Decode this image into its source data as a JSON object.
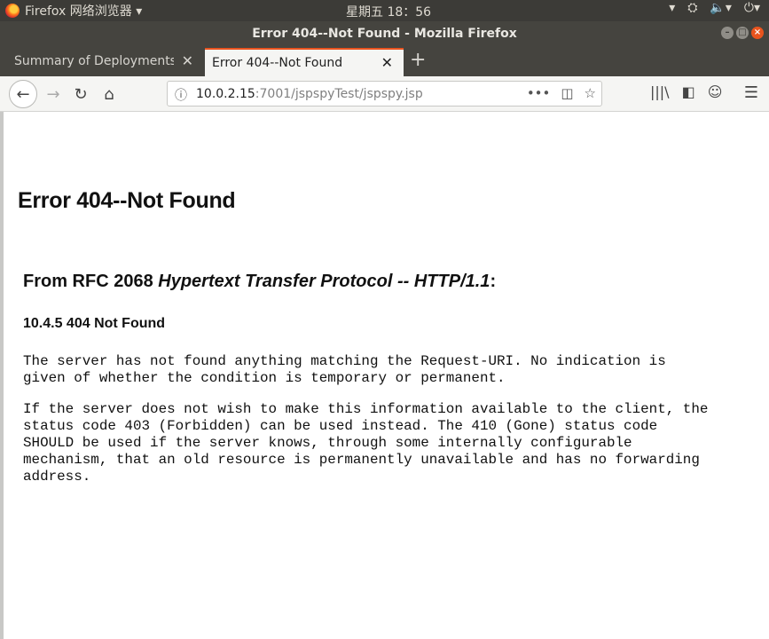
{
  "system_panel": {
    "app_name": "Firefox 网络浏览器 ▾",
    "clock": "星期五 18：56",
    "tray": {
      "dropdown": "▾",
      "network": "⛭",
      "volume": "🔈▾",
      "power": "⏻▾"
    }
  },
  "window": {
    "title": "Error 404--Not Found - Mozilla Firefox",
    "controls": {
      "minimize": "–",
      "maximize": "□",
      "close": "×"
    }
  },
  "tabs": [
    {
      "label": "Summary of Deployments - I",
      "close": "✕",
      "active": false
    },
    {
      "label": "Error 404--Not Found",
      "close": "✕",
      "active": true
    }
  ],
  "new_tab": "+",
  "urlbar": {
    "host": "10.0.2.15",
    "rest": ":7001/jspspyTest/jspspy.jsp",
    "info_icon": "ⓘ",
    "actions": {
      "more": "•••",
      "pocket": "◫",
      "star": "☆"
    }
  },
  "nav": {
    "back": "←",
    "forward": "→",
    "reload": "↻",
    "home": "⌂"
  },
  "toolbar_right": {
    "library": "|||\\",
    "sidebar": "◧",
    "account": "☺",
    "menu": "☰"
  },
  "page": {
    "heading": "Error 404--Not Found",
    "rfc_prefix": "From RFC 2068 ",
    "rfc_title": "Hypertext Transfer Protocol -- HTTP/1.1",
    "rfc_suffix": ":",
    "section": "10.4.5 404 Not Found",
    "para1": "The server has not found anything matching the Request-URI. No indication is\ngiven of whether the condition is temporary or permanent.",
    "para2": "If the server does not wish to make this information available to the client, the\nstatus code 403 (Forbidden) can be used instead. The 410 (Gone) status code\nSHOULD be used if the server knows, through some internally configurable\nmechanism, that an old resource is permanently unavailable and has no forwarding\naddress."
  }
}
